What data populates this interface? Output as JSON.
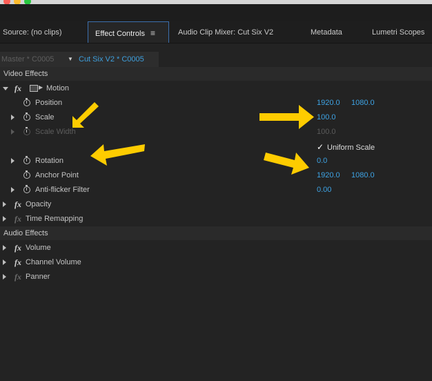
{
  "window": {
    "traffic_colors": [
      "#fe5f57",
      "#febc2e",
      "#28c840"
    ]
  },
  "tabs": [
    {
      "label": "Source: (no clips)"
    },
    {
      "label": "Effect Controls",
      "menu": "≡"
    },
    {
      "label": "Audio Clip Mixer: Cut Six V2"
    },
    {
      "label": "Metadata"
    },
    {
      "label": "Lumetri Scopes"
    }
  ],
  "clip": {
    "master": "Master * C0005",
    "current": "Cut Six V2 * C0005"
  },
  "sections": {
    "video": "Video Effects",
    "audio": "Audio Effects"
  },
  "motion": {
    "label": "Motion",
    "fx": "fx",
    "position": {
      "label": "Position",
      "x": "1920.0",
      "y": "1080.0"
    },
    "scale": {
      "label": "Scale",
      "value": "100.0"
    },
    "scale_width": {
      "label": "Scale Width",
      "value": "100.0"
    },
    "uniform_scale": {
      "label": "Uniform Scale",
      "checked": true
    },
    "rotation": {
      "label": "Rotation",
      "value": "0.0"
    },
    "anchor_point": {
      "label": "Anchor Point",
      "x": "1920.0",
      "y": "1080.0"
    },
    "anti_flicker": {
      "label": "Anti-flicker Filter",
      "value": "0.00"
    }
  },
  "video_effects": [
    {
      "fx": "fx",
      "label": "Opacity"
    },
    {
      "fx": "fx",
      "label": "Time Remapping"
    }
  ],
  "audio_effects": [
    {
      "fx": "fx",
      "label": "Volume"
    },
    {
      "fx": "fx",
      "label": "Channel Volume"
    },
    {
      "fx": "fx",
      "label": "Panner"
    }
  ],
  "annotations": {
    "arrow_color": "#fecc00"
  },
  "colors": {
    "value_blue": "#3ea3e4",
    "panel_bg": "#232323"
  }
}
